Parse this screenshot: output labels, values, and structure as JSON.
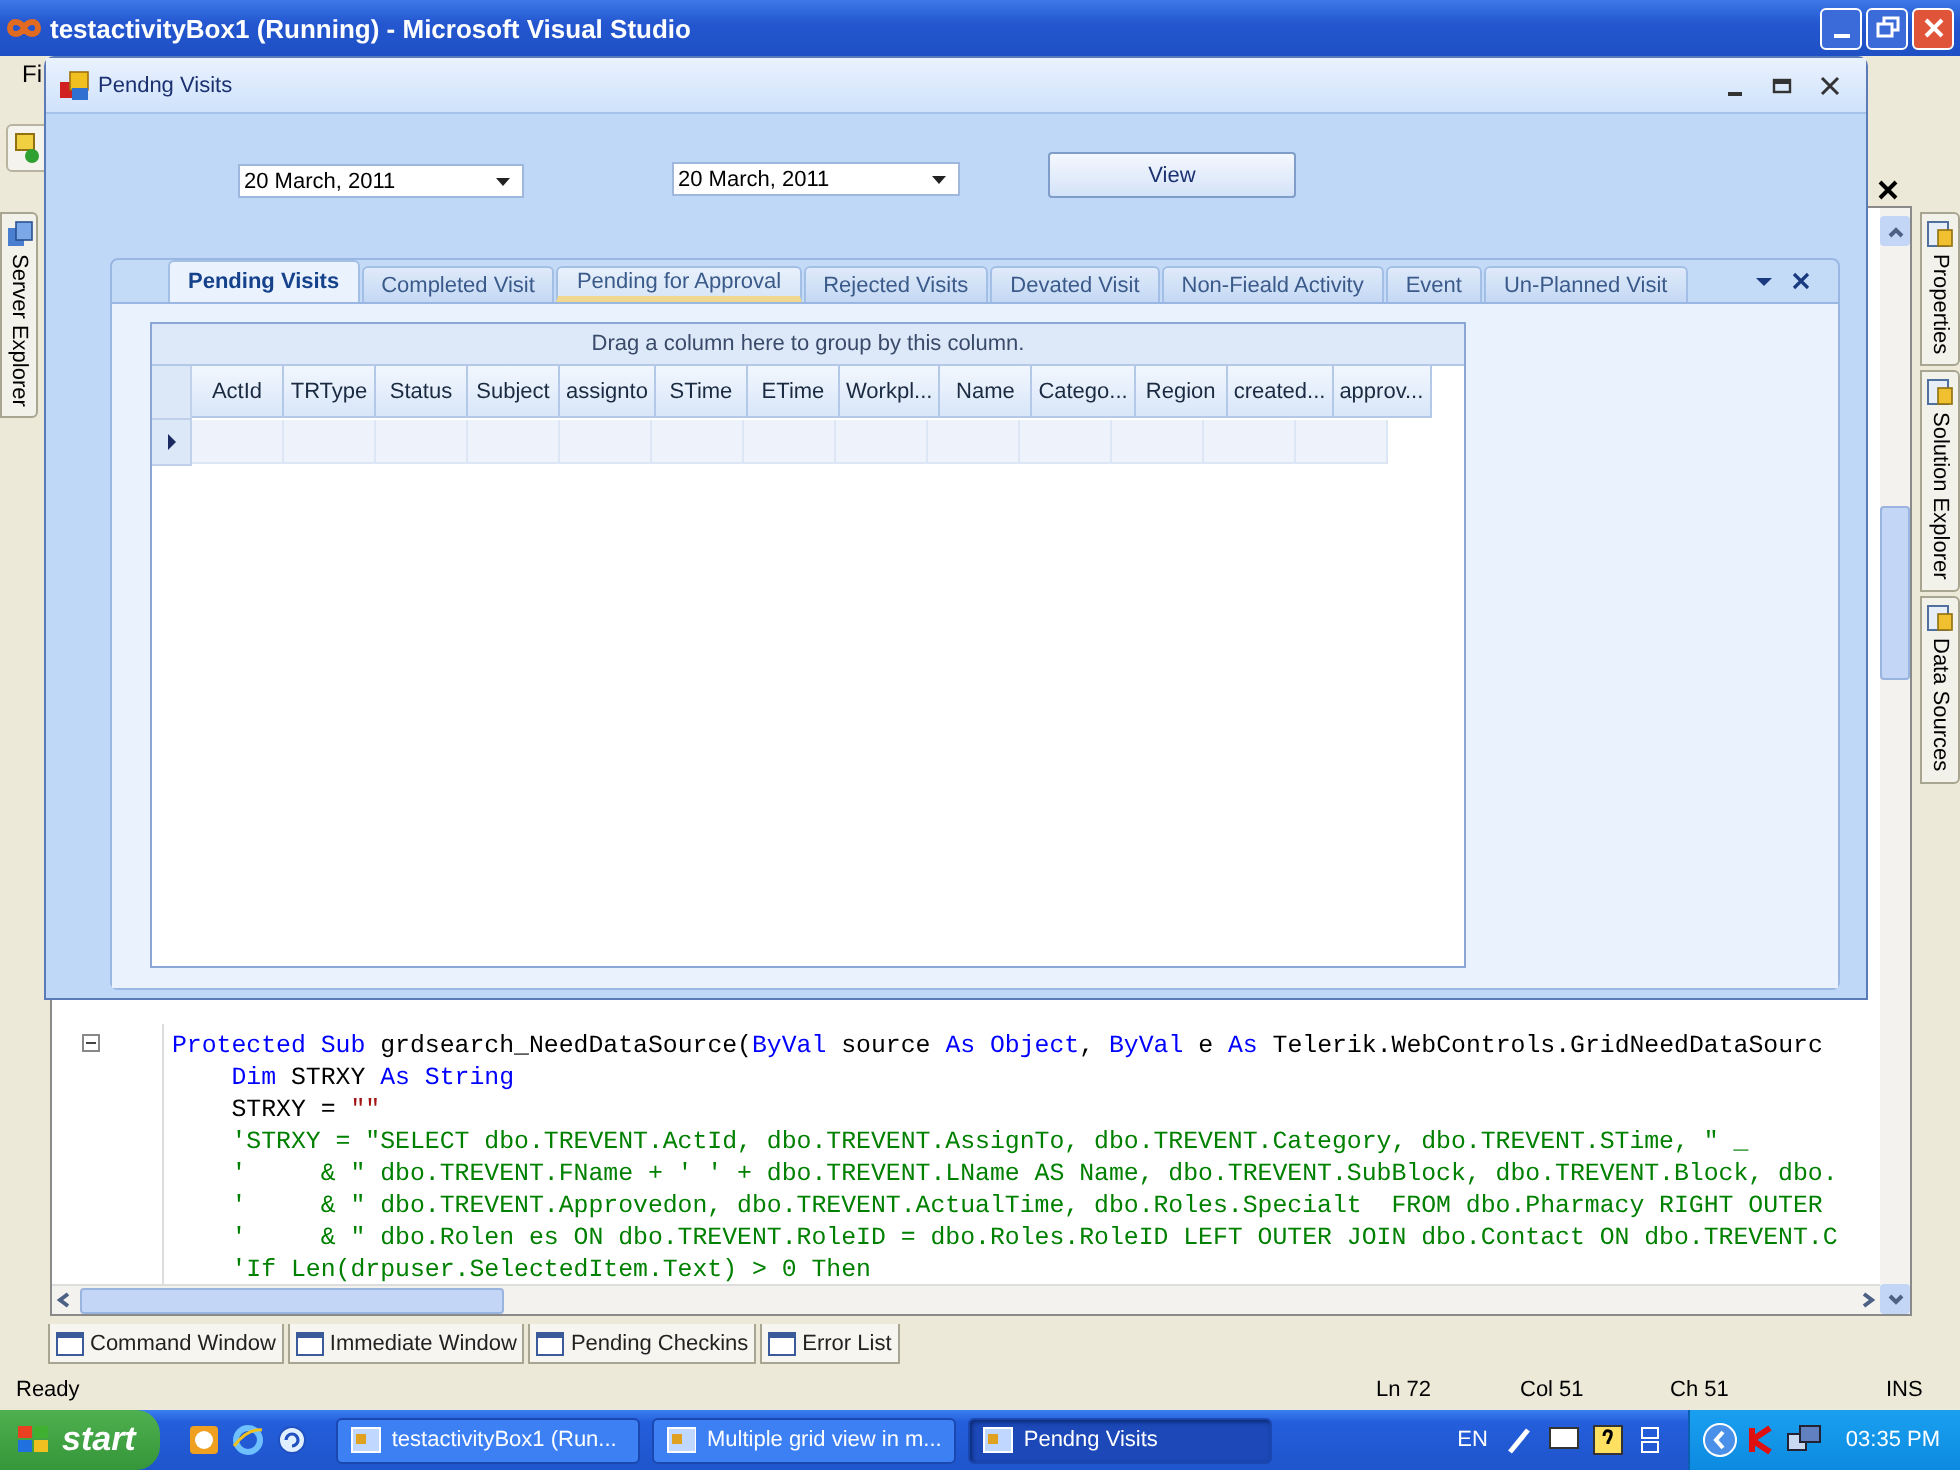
{
  "window": {
    "title": "testactivityBox1 (Running) - Microsoft Visual Studio"
  },
  "menu_partial": "Fi",
  "left_tabs": [
    {
      "label": "Server Explorer"
    }
  ],
  "right_tabs": [
    {
      "label": "Properties"
    },
    {
      "label": "Solution Explorer"
    },
    {
      "label": "Data Sources"
    }
  ],
  "dialog": {
    "title": "Pendng Visits",
    "date_from": "20 March, 2011",
    "date_to": "20 March, 2011",
    "view_button": "View",
    "tabs": [
      {
        "label": "Pending Visits",
        "selected": true,
        "hot": false
      },
      {
        "label": "Completed Visit",
        "selected": false,
        "hot": false
      },
      {
        "label": "Pending for Approval",
        "selected": false,
        "hot": true
      },
      {
        "label": "Rejected Visits",
        "selected": false,
        "hot": false
      },
      {
        "label": "Devated Visit",
        "selected": false,
        "hot": false
      },
      {
        "label": "Non-Fieald Activity",
        "selected": false,
        "hot": false
      },
      {
        "label": "Event",
        "selected": false,
        "hot": false
      },
      {
        "label": "Un-Planned Visit",
        "selected": false,
        "hot": false
      }
    ],
    "grid": {
      "group_hint": "Drag a column here to group by this column.",
      "columns": [
        "ActId",
        "TRType",
        "Status",
        "Subject",
        "assignto",
        "STime",
        "ETime",
        "Workpl...",
        "Name",
        "Catego...",
        "Region",
        "created...",
        "approv..."
      ]
    }
  },
  "code_lines": [
    [
      {
        "kind": "keyword",
        "text": "Protected Sub"
      },
      {
        "kind": "plain",
        "text": " grdsearch_NeedDataSource("
      },
      {
        "kind": "keyword",
        "text": "ByVal"
      },
      {
        "kind": "plain",
        "text": " source "
      },
      {
        "kind": "keyword",
        "text": "As Object"
      },
      {
        "kind": "plain",
        "text": ", "
      },
      {
        "kind": "keyword",
        "text": "ByVal"
      },
      {
        "kind": "plain",
        "text": " e "
      },
      {
        "kind": "keyword",
        "text": "As"
      },
      {
        "kind": "plain",
        "text": " Telerik.WebControls.GridNeedDataSourc"
      }
    ],
    [
      {
        "kind": "keyword",
        "text": "    Dim"
      },
      {
        "kind": "plain",
        "text": " STRXY "
      },
      {
        "kind": "keyword",
        "text": "As String"
      }
    ],
    [
      {
        "kind": "plain",
        "text": "    STRXY = "
      },
      {
        "kind": "string",
        "text": "\"\""
      }
    ],
    [
      {
        "kind": "comment",
        "text": "    'STRXY = \"SELECT dbo.TREVENT.ActId, dbo.TREVENT.AssignTo, dbo.TREVENT.Category, dbo.TREVENT.STime, \" _"
      }
    ],
    [
      {
        "kind": "comment",
        "text": "    '     & \" dbo.TREVENT.FName + ' ' + dbo.TREVENT.LName AS Name, dbo.TREVENT.SubBlock, dbo.TREVENT.Block, dbo."
      }
    ],
    [
      {
        "kind": "comment",
        "text": "    '     & \" dbo.TREVENT.Approvedon, dbo.TREVENT.ActualTime, dbo.Roles.Specialt  FROM dbo.Pharmacy RIGHT OUTER"
      }
    ],
    [
      {
        "kind": "comment",
        "text": "    '     & \" dbo.Rolen es ON dbo.TREVENT.RoleID = dbo.Roles.RoleID LEFT OUTER JOIN dbo.Contact ON dbo.TREVENT.C"
      }
    ],
    [
      {
        "kind": "comment",
        "text": "    'If Len(drpuser.SelectedItem.Text) > 0 Then"
      }
    ]
  ],
  "tool_tabs": [
    {
      "label": "Command Window"
    },
    {
      "label": "Immediate Window"
    },
    {
      "label": "Pending Checkins"
    },
    {
      "label": "Error List"
    }
  ],
  "status_bar": {
    "text": "Ready",
    "line": "Ln 72",
    "col": "Col 51",
    "ch": "Ch 51",
    "mode": "INS"
  },
  "taskbar": {
    "start": "start",
    "tasks": [
      {
        "label": "testactivityBox1 (Run...",
        "selected": false
      },
      {
        "label": "Multiple grid view in m...",
        "selected": false
      },
      {
        "label": "Pendng Visits",
        "selected": true
      }
    ],
    "language": "EN",
    "clock": "03:35 PM"
  }
}
